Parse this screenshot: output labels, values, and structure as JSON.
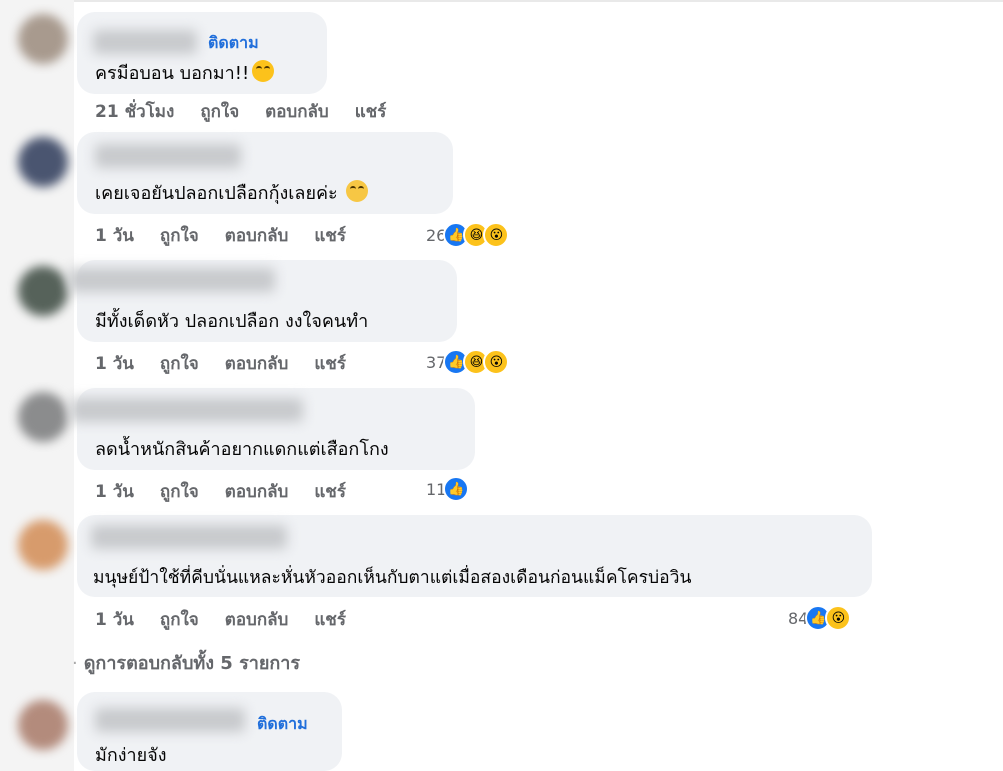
{
  "comments": [
    {
      "follow": "ติดตาม",
      "text": "ครมีอบอน บอกมา!!",
      "emoji": "grinning-sweat-emoji",
      "actions": {
        "time": "21 ชั่วโมง",
        "like": "ถูกใจ",
        "reply": "ตอบกลับ",
        "share": "แชร์"
      }
    },
    {
      "text": "เคยเจอยันปลอกเปลือกกุ้งเลยค่ะ",
      "emoji": "teary-emoji",
      "actions": {
        "time": "1 วัน",
        "like": "ถูกใจ",
        "reply": "ตอบกลับ",
        "share": "แชร์"
      },
      "reaction_count": "26",
      "reactions": [
        "like",
        "haha",
        "wow"
      ]
    },
    {
      "text": "มีทั้งเด็ดหัว ปลอกเปลือก งงใจคนทำ",
      "actions": {
        "time": "1 วัน",
        "like": "ถูกใจ",
        "reply": "ตอบกลับ",
        "share": "แชร์"
      },
      "reaction_count": "37",
      "reactions": [
        "like",
        "haha",
        "wow"
      ]
    },
    {
      "text": "ลดน้ำหนักสินค้าอยากแดกแต่เสือกโกง",
      "actions": {
        "time": "1 วัน",
        "like": "ถูกใจ",
        "reply": "ตอบกลับ",
        "share": "แชร์"
      },
      "reaction_count": "11",
      "reactions": [
        "like"
      ]
    },
    {
      "text": "มนุษย์ป้าใช้ที่คีบนั่นแหละหั่นหัวออกเห็นกับตาแต่เมื่อสองเดือนก่อนแม็คโครบ่อวิน",
      "actions": {
        "time": "1 วัน",
        "like": "ถูกใจ",
        "reply": "ตอบกลับ",
        "share": "แชร์"
      },
      "reaction_count": "84",
      "reactions": [
        "like",
        "wow"
      ]
    },
    {
      "follow": "ติดตาม",
      "text": "มักง่ายจัง"
    }
  ],
  "view_replies": "ดูการตอบกลับทั้ง 5 รายการ",
  "colors": {
    "link": "#216fdb",
    "meta": "#65676b",
    "bubble": "#f0f2f5",
    "like": "#1877f2"
  }
}
